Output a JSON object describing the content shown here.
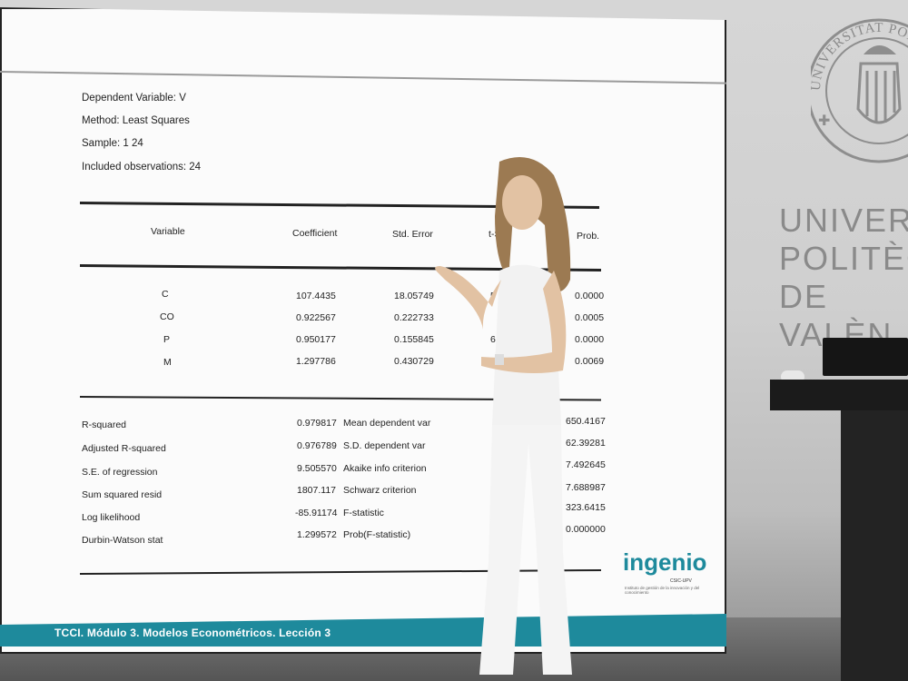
{
  "meta": {
    "dependent": "Dependent Variable: V",
    "method": "Method: Least Squares",
    "sample": "Sample: 1 24",
    "obs": "Included observations: 24"
  },
  "table": {
    "headers": [
      "Variable",
      "Coefficient",
      "Std. Error",
      "t-S",
      "Prob."
    ],
    "rows": [
      {
        "var": "C",
        "coef": "107.4435",
        "se": "18.05749",
        "t": "5",
        "prob": "0.0000"
      },
      {
        "var": "CO",
        "coef": "0.922567",
        "se": "0.222733",
        "t": "",
        "prob": "0.0005"
      },
      {
        "var": "P",
        "coef": "0.950177",
        "se": "0.155845",
        "t": "6",
        "prob": "0.0000"
      },
      {
        "var": "M",
        "coef": "1.297786",
        "se": "0.430729",
        "t": "",
        "prob": "0.0069"
      }
    ]
  },
  "stats": [
    {
      "label": "R-squared",
      "value": "0.979817",
      "label2": "Mean dependent var",
      "value2": "650.4167"
    },
    {
      "label": "Adjusted R-squared",
      "value": "0.976789",
      "label2": "S.D. dependent var",
      "value2": "62.39281"
    },
    {
      "label": "S.E. of regression",
      "value": "9.505570",
      "label2": "Akaike info criterion",
      "value2": "7.492645"
    },
    {
      "label": "Sum squared resid",
      "value": "1807.117",
      "label2": "Schwarz criterion",
      "value2": "7.688987"
    },
    {
      "label": "Log likelihood",
      "value": "-85.91174",
      "label2": "F-statistic",
      "value2": "323.6415"
    },
    {
      "label": "Durbin-Watson stat",
      "value": "1.299572",
      "label2": "Prob(F-statistic)",
      "value2": "0.000000"
    }
  ],
  "footer": "TCCI. Módulo 3. Modelos Econométricos. Lección 3",
  "logo": {
    "name": "ingenio",
    "sub": "CSIC-UPV",
    "tagline": "Instituto de gestión de la innovación y del conocimiento"
  },
  "university": {
    "line1": "UNIVERS",
    "line2": "POLITÈC",
    "line3": "DE VALÈN",
    "seal_text": "UNIVERSITAT POLITÈCNICA DE VALÈNCIA"
  },
  "colors": {
    "accent": "#1e8a9c",
    "slide_bg": "#fbfbfb",
    "wall": "#d0d0d0"
  }
}
